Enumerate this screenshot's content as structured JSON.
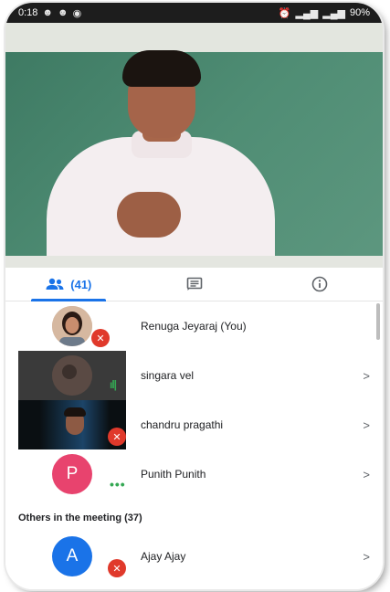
{
  "status_bar": {
    "left_text": "0:18",
    "right_text": "90%"
  },
  "tabs": [
    {
      "label": "(41)",
      "icon": "people-icon",
      "active": true
    },
    {
      "label": "",
      "icon": "chat-icon",
      "active": false
    },
    {
      "label": "",
      "icon": "info-icon",
      "active": false
    }
  ],
  "participants": [
    {
      "name": "Renuga Jeyaraj (You)",
      "muted": true,
      "has_chevron": false
    },
    {
      "name": "singara vel",
      "speaking": true,
      "has_chevron": true
    },
    {
      "name": "chandru pragathi",
      "muted": true,
      "has_chevron": true
    },
    {
      "name": "Punith Punith",
      "initial": "P",
      "has_chevron": true
    }
  ],
  "others_section": {
    "label": "Others in the meeting (37)",
    "participants": [
      {
        "name": "Ajay Ajay",
        "initial": "A",
        "muted": true,
        "has_chevron": true
      }
    ]
  },
  "colors": {
    "accent": "#1a73e8",
    "mute_red": "#e0392b",
    "speaking_green": "#34a853",
    "avatar_pink": "#e8436e",
    "avatar_blue": "#1a73e8"
  },
  "chevron_glyph": ">"
}
